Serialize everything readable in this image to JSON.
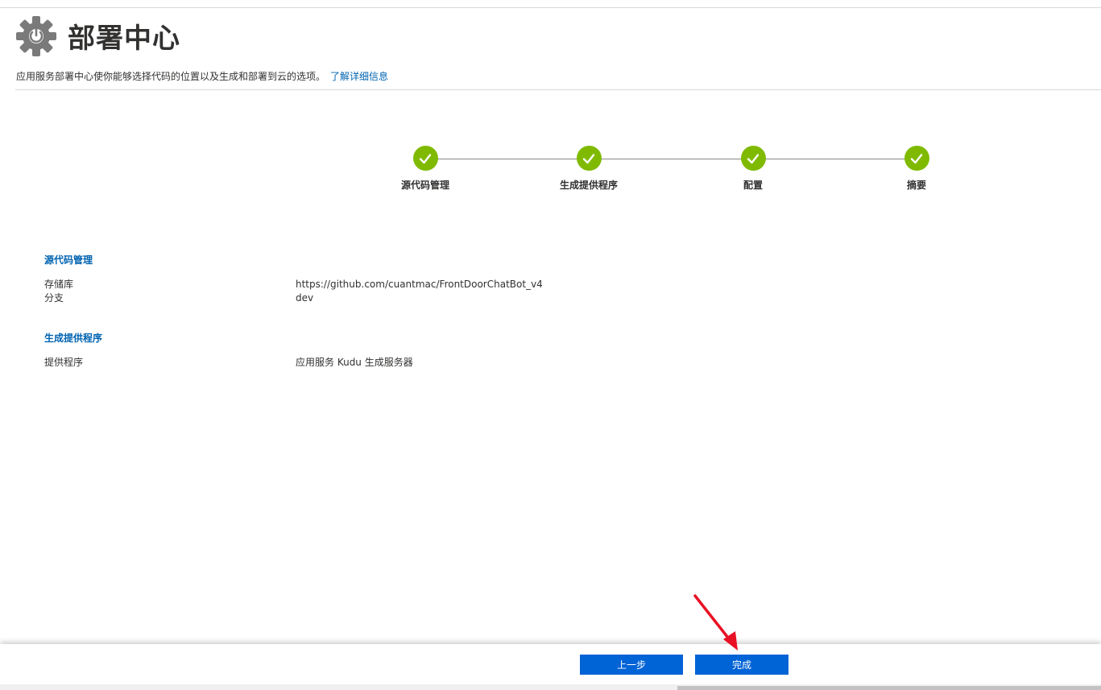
{
  "header": {
    "icon": "gear-power-icon",
    "title": "部署中心",
    "description": "应用服务部署中心使你能够选择代码的位置以及生成和部署到云的选项。",
    "learn_more_link": "了解详细信息"
  },
  "stepper": {
    "steps": [
      {
        "label": "源代码管理",
        "status": "complete"
      },
      {
        "label": "生成提供程序",
        "status": "complete"
      },
      {
        "label": "配置",
        "status": "complete"
      },
      {
        "label": "摘要",
        "status": "complete"
      }
    ],
    "complete_color": "#7fba00"
  },
  "summary": {
    "source_control": {
      "title": "源代码管理",
      "rows": [
        {
          "label": "存储库",
          "value": "https://github.com/cuantmac/FrontDoorChatBot_v4"
        },
        {
          "label": "分支",
          "value": "dev"
        }
      ]
    },
    "build_provider": {
      "title": "生成提供程序",
      "rows": [
        {
          "label": "提供程序",
          "value": "应用服务 Kudu 生成服务器"
        }
      ]
    }
  },
  "footer": {
    "previous_label": "上一步",
    "finish_label": "完成"
  },
  "colors": {
    "accent": "#0063b1",
    "button": "#0063d6",
    "annotation_arrow": "#e81123"
  }
}
